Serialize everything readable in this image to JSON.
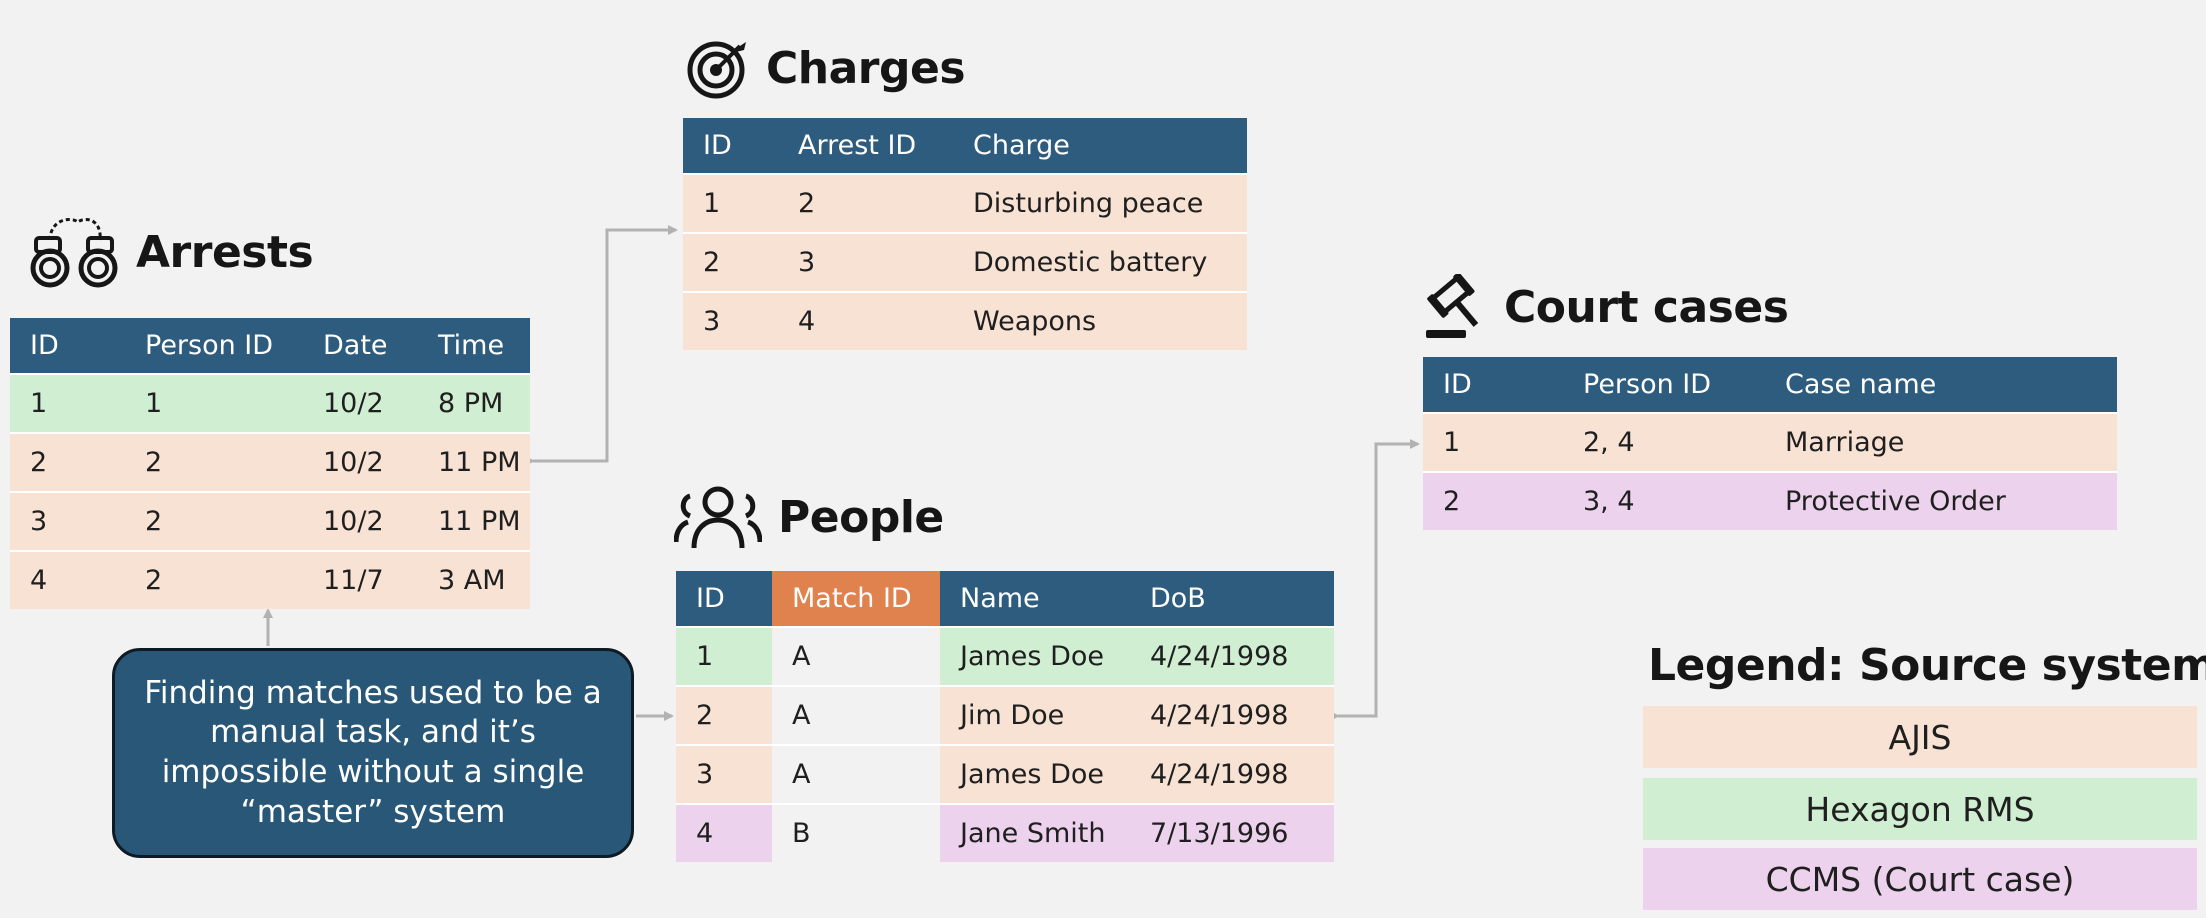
{
  "arrests": {
    "title": "Arrests",
    "headers": [
      "ID",
      "Person ID",
      "Date",
      "Time"
    ],
    "rows": [
      {
        "cells": [
          "1",
          "1",
          "10/2",
          "8 PM"
        ],
        "source": "Hexagon RMS"
      },
      {
        "cells": [
          "2",
          "2",
          "10/2",
          "11 PM"
        ],
        "source": "AJIS"
      },
      {
        "cells": [
          "3",
          "2",
          "10/2",
          "11 PM"
        ],
        "source": "AJIS"
      },
      {
        "cells": [
          "4",
          "2",
          "11/7",
          "3 AM"
        ],
        "source": "AJIS"
      }
    ]
  },
  "charges": {
    "title": "Charges",
    "headers": [
      "ID",
      "Arrest ID",
      "Charge"
    ],
    "rows": [
      {
        "cells": [
          "1",
          "2",
          "Disturbing peace"
        ],
        "source": "AJIS"
      },
      {
        "cells": [
          "2",
          "3",
          "Domestic battery"
        ],
        "source": "AJIS"
      },
      {
        "cells": [
          "3",
          "4",
          "Weapons"
        ],
        "source": "AJIS"
      }
    ]
  },
  "people": {
    "title": "People",
    "headers": [
      "ID",
      "Match ID",
      "Name",
      "DoB"
    ],
    "rows": [
      {
        "cells": [
          "1",
          "A",
          "James Doe",
          "4/24/1998"
        ],
        "source": "Hexagon RMS"
      },
      {
        "cells": [
          "2",
          "A",
          "Jim Doe",
          "4/24/1998"
        ],
        "source": "AJIS"
      },
      {
        "cells": [
          "3",
          "A",
          "James Doe",
          "4/24/1998"
        ],
        "source": "AJIS"
      },
      {
        "cells": [
          "4",
          "B",
          "Jane Smith",
          "7/13/1996"
        ],
        "source": "CCMS (Court case)"
      }
    ]
  },
  "court_cases": {
    "title": "Court cases",
    "headers": [
      "ID",
      "Person ID",
      "Case name"
    ],
    "rows": [
      {
        "cells": [
          "1",
          "2, 4",
          "Marriage"
        ],
        "source": "AJIS"
      },
      {
        "cells": [
          "2",
          "3, 4",
          "Protective Order"
        ],
        "source": "CCMS (Court case)"
      }
    ]
  },
  "callout": {
    "text": "Finding matches used to be a manual task, and it’s impossible without a single “master” system"
  },
  "legend": {
    "title": "Legend: Source system",
    "items": [
      {
        "label": "AJIS",
        "color": "#f7e2d4"
      },
      {
        "label": "Hexagon RMS",
        "color": "#d0eed1"
      },
      {
        "label": "CCMS (Court case)",
        "color": "#ecd2ec"
      }
    ]
  },
  "colors": {
    "header": "#2e5c7e",
    "match_header": "#e0824d",
    "callout": "#285777",
    "connector": "#b2b2b2"
  },
  "icons": {
    "arrests": "handcuffs-icon",
    "charges": "target-icon",
    "people": "people-icon",
    "court_cases": "gavel-icon"
  }
}
